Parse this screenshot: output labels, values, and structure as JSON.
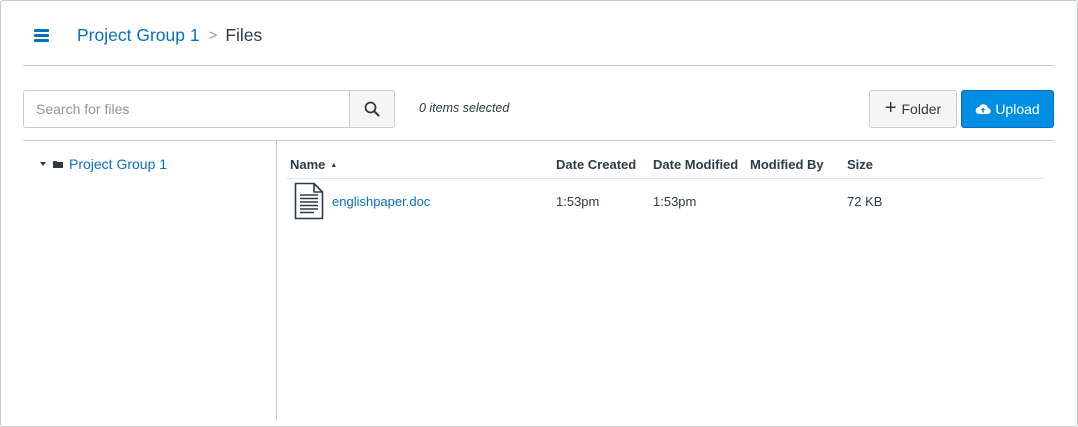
{
  "header": {
    "menu_icon": "hamburger-icon",
    "breadcrumb": {
      "parent": "Project Group 1",
      "separator": ">",
      "current": "Files"
    }
  },
  "toolbar": {
    "search_placeholder": "Search for files",
    "search_icon": "search-icon",
    "selected_text": "0 items selected",
    "folder_label": "Folder",
    "upload_label": "Upload"
  },
  "tree": {
    "items": [
      {
        "label": "Project Group 1",
        "expanded": true
      }
    ]
  },
  "table": {
    "columns": {
      "name": "Name",
      "date_created": "Date Created",
      "date_modified": "Date Modified",
      "modified_by": "Modified By",
      "size": "Size"
    },
    "sort_indicator": "▲",
    "rows": [
      {
        "name": "englishpaper.doc",
        "date_created": "1:53pm",
        "date_modified": "1:53pm",
        "modified_by": "",
        "size": "72 KB",
        "icon": "document-icon"
      }
    ]
  },
  "colors": {
    "link": "#0770c0",
    "primary_button": "#008ee2",
    "border": "#c7cdd1",
    "text": "#2d3b45"
  }
}
